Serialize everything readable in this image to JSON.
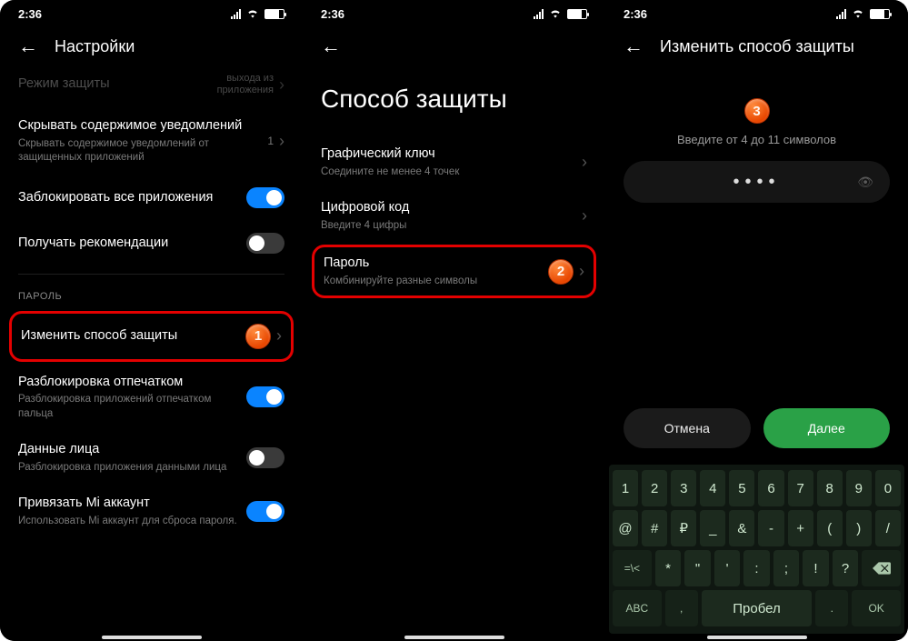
{
  "status": {
    "time": "2:36"
  },
  "screen1": {
    "title": "Настройки",
    "mode_label": "Режим защиты",
    "mode_sub": "выхода из приложения",
    "hide_title": "Скрывать содержимое уведомлений",
    "hide_sub": "Скрывать содержимое уведомлений от защищенных приложений",
    "hide_value": "1",
    "lock_all": "Заблокировать все приложения",
    "recs": "Получать рекомендации",
    "section_password": "ПАРОЛЬ",
    "change_method": "Изменить способ защиты",
    "fp_title": "Разблокировка отпечатком",
    "fp_sub": "Разблокировка приложений отпечатком пальца",
    "face_title": "Данные лица",
    "face_sub": "Разблокировка приложения данными лица",
    "mi_title": "Привязать Mi аккаунт",
    "mi_sub": "Использовать Mi аккаунт для сброса пароля.",
    "badge": "1"
  },
  "screen2": {
    "title": "Способ защиты",
    "pattern_title": "Графический ключ",
    "pattern_sub": "Соедините не менее 4 точек",
    "pin_title": "Цифровой код",
    "pin_sub": "Введите 4 цифры",
    "pwd_title": "Пароль",
    "pwd_sub": "Комбинируйте разные символы",
    "badge": "2"
  },
  "screen3": {
    "title": "Изменить способ защиты",
    "badge": "3",
    "hint": "Введите от 4 до 11 символов",
    "dots": "••••",
    "cancel": "Отмена",
    "next": "Далее",
    "kb": {
      "r1": [
        "1",
        "2",
        "3",
        "4",
        "5",
        "6",
        "7",
        "8",
        "9",
        "0"
      ],
      "r2": [
        "@",
        "#",
        "₽",
        "_",
        "&",
        "-",
        "+",
        "(",
        ")",
        "/"
      ],
      "r3_first": "=\\<",
      "r3": [
        "*",
        "\"",
        "'",
        ":",
        ";",
        "!",
        "?"
      ],
      "r4_abc": "ABC",
      "r4_comma": ",",
      "r4_space": "Пробел",
      "r4_dot": ".",
      "r4_ok": "OK"
    }
  }
}
